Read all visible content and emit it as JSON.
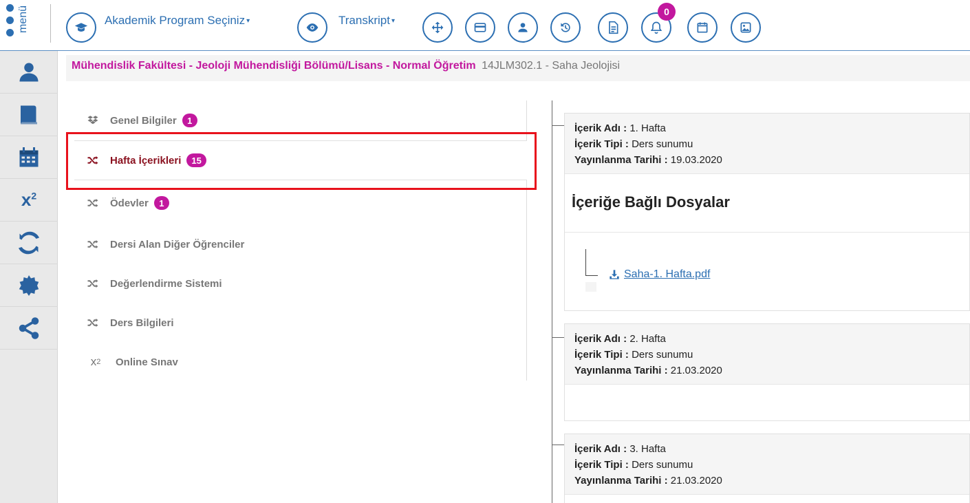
{
  "topbar": {
    "menu_label": "menü",
    "program_label": "Akademik Program Seçiniz",
    "transcript_label": "Transkript",
    "notification_count": "0"
  },
  "breadcrumb": {
    "path": "Mühendislik Fakültesi - Jeoloji Mühendisliği Bölümü/Lisans - Normal Öğretim",
    "course": "14JLM302.1 - Saha Jeolojisi"
  },
  "course_menu": {
    "items": [
      {
        "label": "Genel Bilgiler",
        "badge": "1",
        "icon": "dropbox-icon"
      },
      {
        "label": "Hafta İçerikleri",
        "badge": "15",
        "icon": "shuffle-icon",
        "active": true
      },
      {
        "label": "Ödevler",
        "badge": "1",
        "icon": "shuffle-icon"
      },
      {
        "label": "Dersi Alan Diğer Öğrenciler",
        "icon": "shuffle-icon"
      },
      {
        "label": "Değerlendirme Sistemi",
        "icon": "shuffle-icon"
      },
      {
        "label": "Ders Bilgileri",
        "icon": "shuffle-icon"
      },
      {
        "label": "Online Sınav",
        "icon": "superscript-icon"
      }
    ]
  },
  "labels": {
    "content_name": "İçerik Adı :",
    "content_type": "İçerik Tipi :",
    "publish_date": "Yayınlanma Tarihi :",
    "files_title": "İçeriğe Bağlı Dosyalar"
  },
  "contents": [
    {
      "name": "1. Hafta",
      "type": "Ders sunumu",
      "date": "19.03.2020",
      "file": "Saha-1. Hafta.pdf"
    },
    {
      "name": "2. Hafta",
      "type": "Ders sunumu",
      "date": "21.03.2020"
    },
    {
      "name": "3. Hafta",
      "type": "Ders sunumu",
      "date": "21.03.2020"
    }
  ],
  "colors": {
    "primary": "#2c6fb2",
    "badge": "#c2189e",
    "active_item": "#8b1220",
    "highlight": "#e8121c"
  }
}
